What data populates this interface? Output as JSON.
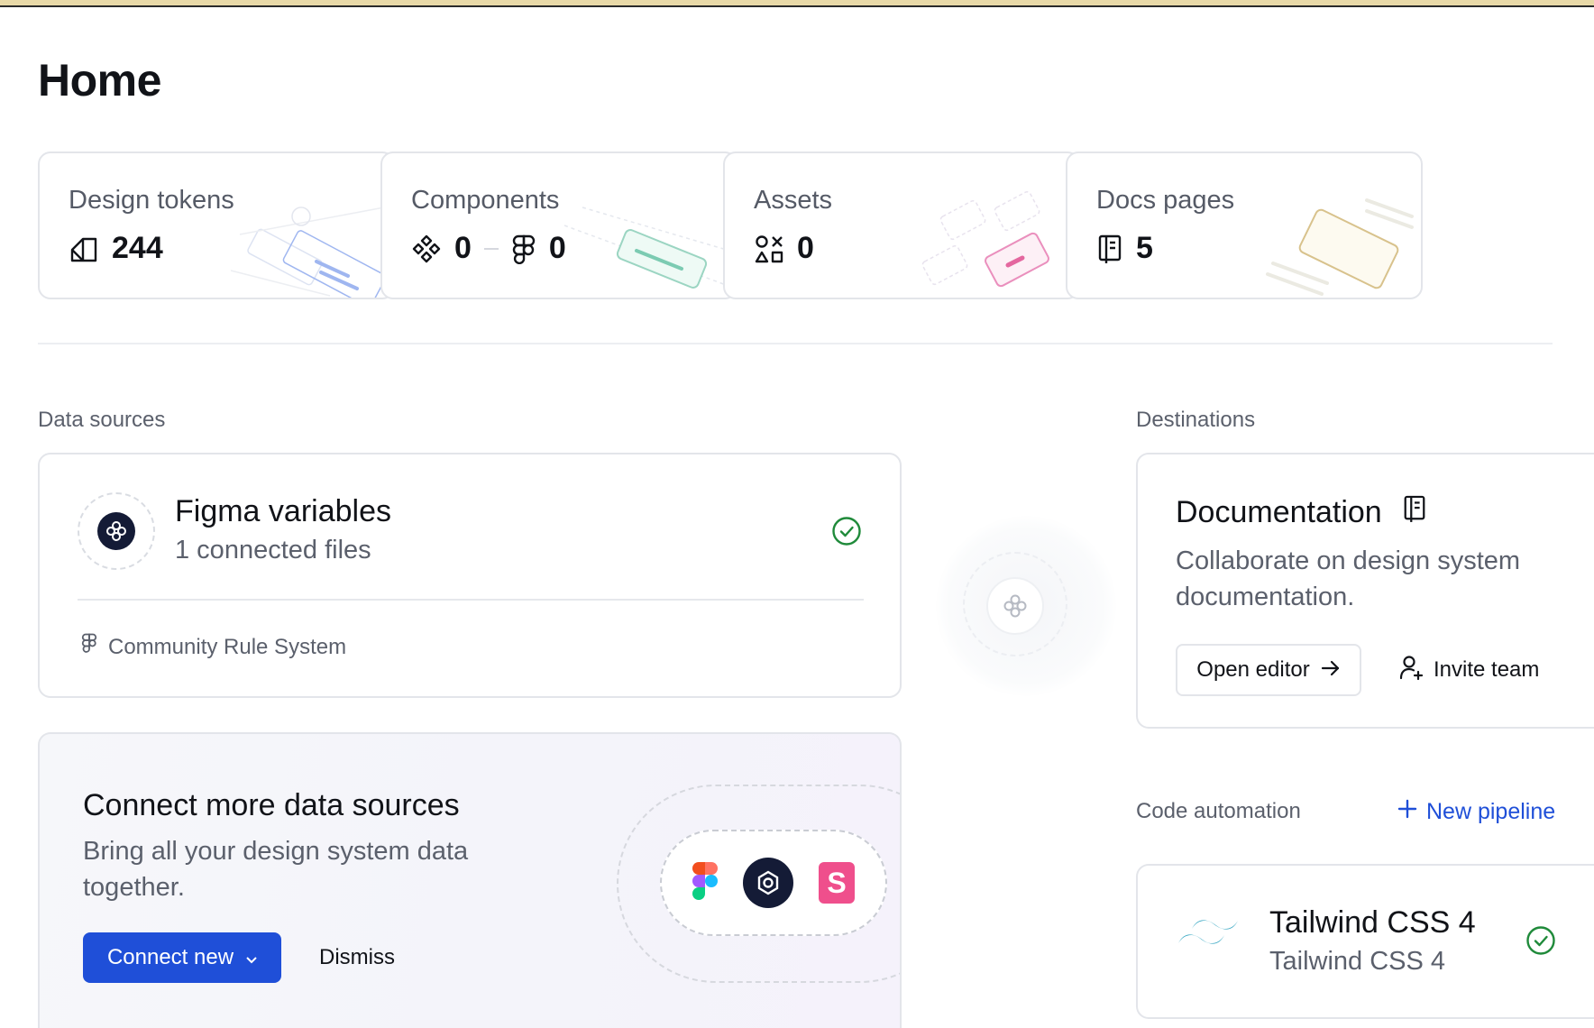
{
  "page": {
    "title": "Home"
  },
  "stats": [
    {
      "label": "Design tokens",
      "value": "244",
      "icon": "design-token-icon"
    },
    {
      "label": "Components",
      "value_a": "0",
      "value_b": "0",
      "icon_a": "component-icon",
      "icon_b": "figma-icon"
    },
    {
      "label": "Assets",
      "value": "0",
      "icon": "assets-icon"
    },
    {
      "label": "Docs pages",
      "value": "5",
      "icon": "book-icon"
    }
  ],
  "data_sources": {
    "label": "Data sources",
    "figma": {
      "title": "Figma variables",
      "subtitle": "1 connected files",
      "file_name": "Community Rule System",
      "status_icon": "check-circle-icon"
    },
    "connect": {
      "title": "Connect more data sources",
      "subtitle": "Bring all your design system data together.",
      "primary_button": "Connect new",
      "dismiss_button": "Dismiss",
      "logos": [
        "figma-logo",
        "tokens-studio-logo",
        "storybook-logo"
      ]
    }
  },
  "destinations": {
    "label": "Destinations",
    "documentation": {
      "title": "Documentation",
      "subtitle": "Collaborate on design system documentation.",
      "open_editor": "Open editor",
      "invite_team": "Invite team"
    }
  },
  "code_automation": {
    "label": "Code automation",
    "new_pipeline": "New pipeline",
    "pipeline": {
      "title": "Tailwind CSS 4",
      "subtitle": "Tailwind CSS 4",
      "status_icon": "check-circle-icon"
    }
  },
  "colors": {
    "accent": "#1f4fd8",
    "success": "#1f8a3a",
    "tailwind": "#38bdf8"
  }
}
